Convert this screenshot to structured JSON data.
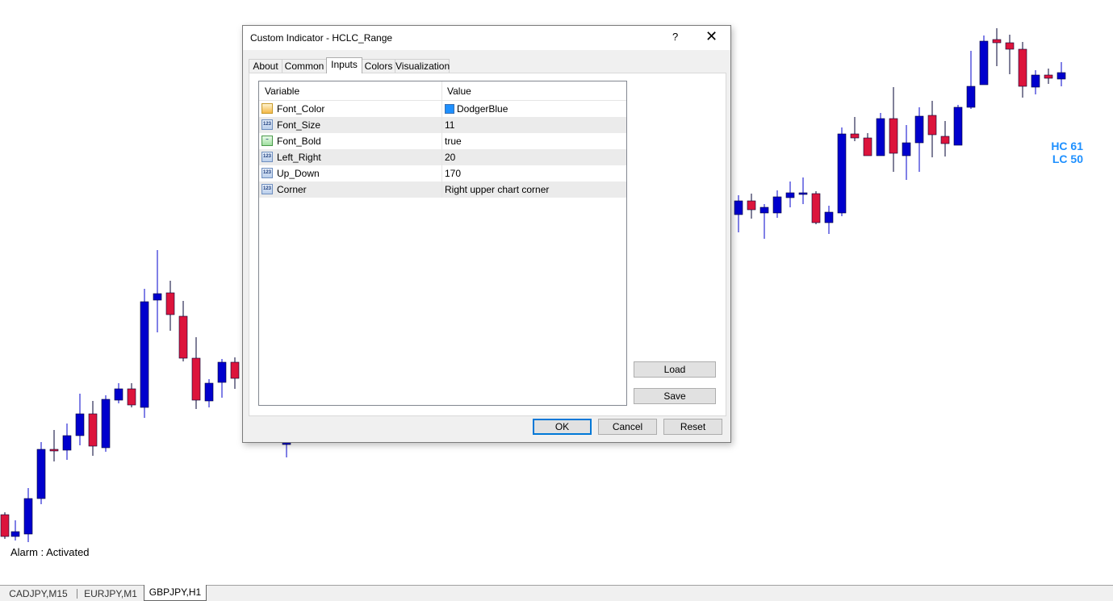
{
  "dialog": {
    "title": "Custom Indicator - HCLC_Range",
    "help_label": "?",
    "close_label": "✕",
    "tabs": [
      {
        "label": "About"
      },
      {
        "label": "Common"
      },
      {
        "label": "Inputs"
      },
      {
        "label": "Colors"
      },
      {
        "label": "Visualization"
      }
    ],
    "active_tab": "Inputs",
    "grid": {
      "col_variable": "Variable",
      "col_value": "Value",
      "rows": [
        {
          "variable": "Font_Color",
          "value": "DodgerBlue",
          "type": "color-icon",
          "swatch": "#1e90ff"
        },
        {
          "variable": "Font_Size",
          "value": "11",
          "type": "number-icon"
        },
        {
          "variable": "Font_Bold",
          "value": "true",
          "type": "bool-icon"
        },
        {
          "variable": "Left_Right",
          "value": "20",
          "type": "number-icon"
        },
        {
          "variable": "Up_Down",
          "value": "170",
          "type": "number-icon"
        },
        {
          "variable": "Corner",
          "value": "Right upper chart corner",
          "type": "number-icon"
        }
      ]
    },
    "load_label": "Load",
    "save_label": "Save",
    "ok_label": "OK",
    "cancel_label": "Cancel",
    "reset_label": "Reset"
  },
  "chart": {
    "indicator_line1": "HC 61",
    "indicator_line2": "LC 50",
    "alarm_text": "Alarm : Activated",
    "bull_color": "#0000cd",
    "bear_color": "#dc143c",
    "text_color": "#1e90ff"
  },
  "chart_tabs": [
    {
      "label": "CADJPY,M15"
    },
    {
      "label": "EURJPY,M1"
    },
    {
      "label": "GBPJPY,H1"
    }
  ],
  "active_chart_tab": "GBPJPY,H1"
}
